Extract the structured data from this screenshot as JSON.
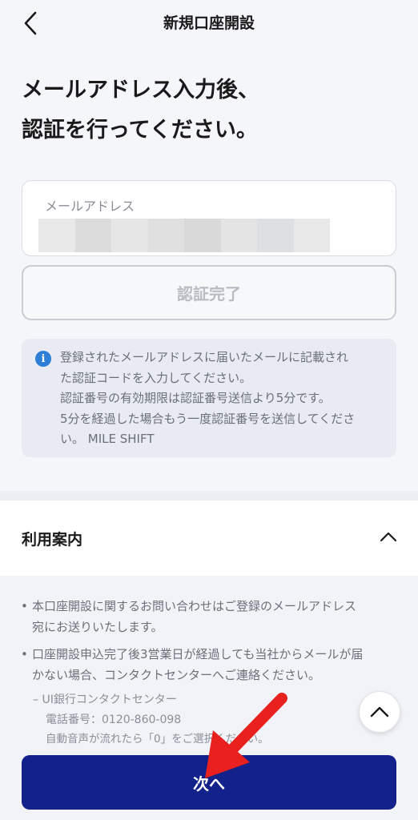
{
  "header": {
    "title": "新規口座開設",
    "back_icon": "chevron-left-icon"
  },
  "headline": {
    "line1": "メールアドレス入力後、",
    "line2": "認証を行ってください。"
  },
  "email_field": {
    "label": "メールアドレス",
    "value_redacted": true
  },
  "verify_button": {
    "label": "認証完了",
    "state": "disabled"
  },
  "info": {
    "icon": "info-icon",
    "lines": [
      "登録されたメールアドレスに届いたメールに記載され",
      "た認証コードを入力してください。",
      "認証番号の有効期限は認証番号送信より5分です。",
      "5分を経過した場合もう一度認証番号を送信してくださ",
      "い。 MILE SHIFT"
    ]
  },
  "guide": {
    "title": "利用案内",
    "toggle_icon": "chevron-up-icon",
    "bullets": [
      {
        "line1": "本口座開設に関するお問い合わせはご登録のメールアドレス",
        "line2": "宛にお送りいたします。"
      },
      {
        "line1": "口座開設申込完了後3営業日が経過しても当社からメールが届",
        "line2": "かない場合、コンタクトセンターへご連絡ください。"
      }
    ],
    "contact": {
      "name": "UI銀行コンタクトセンター",
      "phone": "電話番号：0120-860-098",
      "note": "自動音声が流れたら「0」をご選択ください。"
    }
  },
  "scroll_top_icon": "chevron-up-icon",
  "next_button": {
    "label": "次へ"
  },
  "annotation": {
    "icon": "red-arrow-icon",
    "color": "#e8201e"
  },
  "colors": {
    "primary": "#12228a",
    "info_icon": "#2d7fd6",
    "background": "#f5f6f9"
  }
}
